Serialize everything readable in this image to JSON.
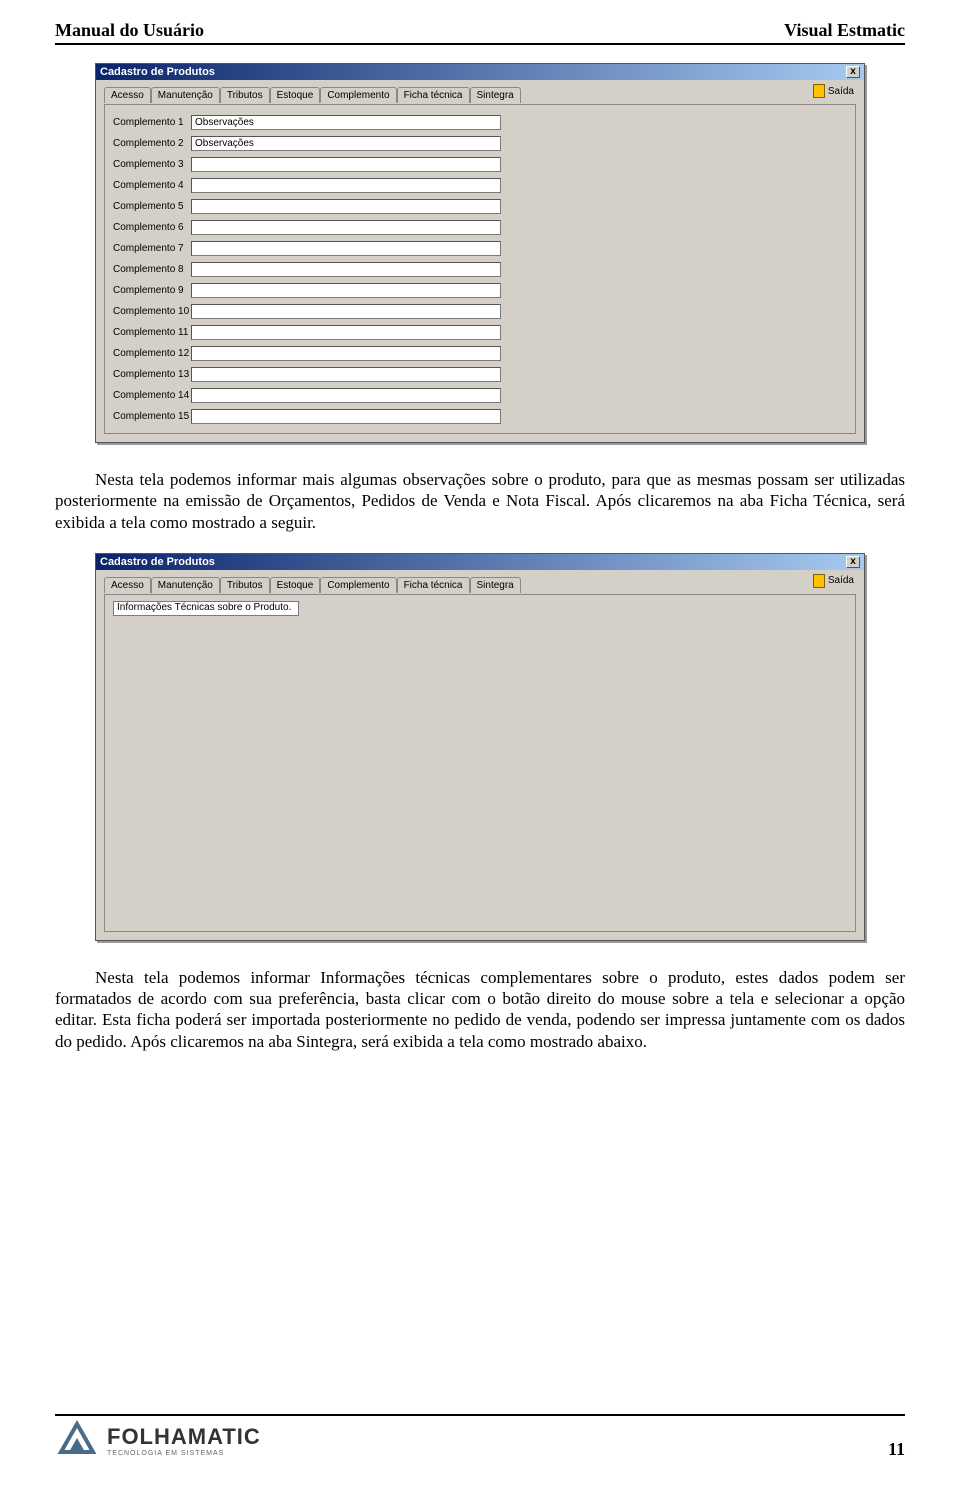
{
  "header": {
    "left": "Manual do Usuário",
    "right": "Visual Estmatic"
  },
  "window1": {
    "title": "Cadastro de Produtos",
    "close": "x",
    "saida": "Saída",
    "tabs": [
      "Acesso",
      "Manutenção",
      "Tributos",
      "Estoque",
      "Complemento",
      "Ficha técnica",
      "Sintegra"
    ],
    "activeTab": "Complemento",
    "fields": [
      {
        "label": "Complemento 1",
        "value": "Observações"
      },
      {
        "label": "Complemento 2",
        "value": "Observações"
      },
      {
        "label": "Complemento 3",
        "value": ""
      },
      {
        "label": "Complemento 4",
        "value": ""
      },
      {
        "label": "Complemento 5",
        "value": ""
      },
      {
        "label": "Complemento 6",
        "value": ""
      },
      {
        "label": "Complemento 7",
        "value": ""
      },
      {
        "label": "Complemento 8",
        "value": ""
      },
      {
        "label": "Complemento 9",
        "value": ""
      },
      {
        "label": "Complemento 10",
        "value": ""
      },
      {
        "label": "Complemento 11",
        "value": ""
      },
      {
        "label": "Complemento 12",
        "value": ""
      },
      {
        "label": "Complemento 13",
        "value": ""
      },
      {
        "label": "Complemento 14",
        "value": ""
      },
      {
        "label": "Complemento 15",
        "value": ""
      }
    ]
  },
  "para1": "Nesta tela podemos informar mais algumas observações sobre o produto, para que as mesmas possam ser utilizadas posteriormente na emissão de Orçamentos, Pedidos de Venda e Nota Fiscal. Após clicaremos na aba Ficha Técnica, será exibida a tela como mostrado a seguir.",
  "window2": {
    "title": "Cadastro de Produtos",
    "close": "x",
    "saida": "Saída",
    "tabs": [
      "Acesso",
      "Manutenção",
      "Tributos",
      "Estoque",
      "Complemento",
      "Ficha técnica",
      "Sintegra"
    ],
    "activeTab": "Ficha técnica",
    "textbox": "Informações Técnicas sobre o Produto."
  },
  "para2": "Nesta tela podemos informar Informações técnicas complementares sobre o produto, estes dados podem ser formatados de acordo com sua preferência, basta clicar com o botão direito do mouse sobre a tela e selecionar a opção editar. Esta ficha poderá ser importada posteriormente no pedido de venda, podendo ser impressa juntamente com os dados do pedido. Após clicaremos na aba Sintegra, será exibida a tela como mostrado abaixo.",
  "footer": {
    "brand": "FOLHAMATIC",
    "tagline": "TECNOLOGIA EM SISTEMAS",
    "page": "11"
  }
}
